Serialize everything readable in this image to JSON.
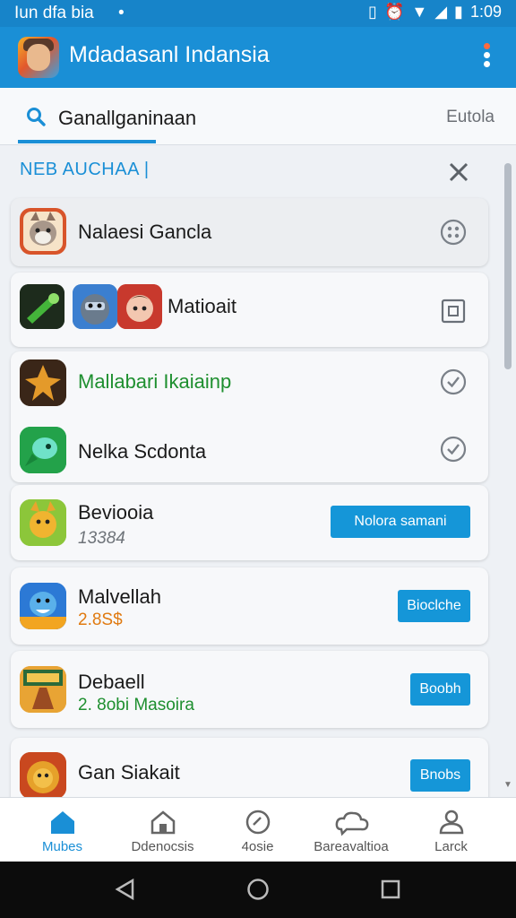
{
  "status_bar": {
    "left_text": "Iun dfa bia",
    "dot": "•",
    "time": "1:09"
  },
  "app_bar": {
    "title": "Mdadasanl Indansia",
    "logo_icon": "game-character-icon",
    "menu_icon": "overflow-menu-icon"
  },
  "tabs": {
    "search_tab_label": "Ganallganinaan",
    "right_tab_label": "Eutola",
    "accent_color": "#1a8fd6"
  },
  "section": {
    "header": "NEB AUCHAA |",
    "close_icon": "close-icon"
  },
  "rows": [
    {
      "title": "Nalaesi Gancla",
      "control": "options-circle-icon"
    },
    {
      "title": "Matioait",
      "control": "checkbox-square-icon"
    },
    {
      "title": "Mallabari Ikaiainp",
      "title_color": "#1e8f2f",
      "control": "checkmark-circle-icon"
    },
    {
      "title": "Nelka Scdonta",
      "control": "checkmark-circle-icon"
    },
    {
      "title": "Beviooia",
      "subtitle": "13384",
      "button": "Nolora samani"
    },
    {
      "title": "Malvellah",
      "subtitle": "2.8S$",
      "subtitle_color": "#e07a10",
      "button": "Bioclche"
    },
    {
      "title": "Debaell",
      "subtitle": "2. 8obi Masoira",
      "subtitle_color": "#1e8f2f",
      "button": "Boobh"
    },
    {
      "title": "Gan Siakait",
      "subtitle": "",
      "button": "Bnobs"
    }
  ],
  "bottom_nav": [
    {
      "label": "Mubes",
      "icon": "home-icon",
      "active": true
    },
    {
      "label": "Ddenocsis",
      "icon": "house-outline-icon",
      "active": false
    },
    {
      "label": "4osie",
      "icon": "clock-circle-icon",
      "active": false
    },
    {
      "label": "Bareavaltioa",
      "icon": "chat-cloud-icon",
      "active": false
    },
    {
      "label": "Larck",
      "icon": "person-icon",
      "active": false
    }
  ],
  "system_nav": {
    "back_icon": "back-triangle-icon",
    "home_icon": "home-circle-icon",
    "recents_icon": "recents-square-icon"
  }
}
